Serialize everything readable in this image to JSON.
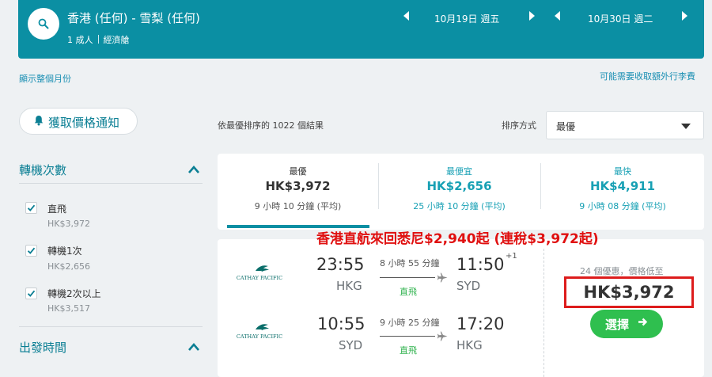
{
  "header": {
    "route": "香港 (任何) - 雪梨 (任何)",
    "passengers": "1 成人",
    "cabin": "經濟艙",
    "depart_date": "10月19日 週五",
    "return_date": "10月30日 週二"
  },
  "links": {
    "show_month": "顯示整個月份",
    "extra_baggage": "可能需要收取額外行李費"
  },
  "sidebar": {
    "price_alert": "獲取價格通知",
    "stops_title": "轉機次數",
    "stops": [
      {
        "label": "直飛",
        "price": "HK$3,972",
        "checked": true
      },
      {
        "label": "轉機1次",
        "price": "HK$2,656",
        "checked": true
      },
      {
        "label": "轉機2次以上",
        "price": "HK$3,517",
        "checked": true
      }
    ],
    "departure_title": "出發時間"
  },
  "sort": {
    "results": "依最優排序的 1022 個結果",
    "label": "排序方式",
    "value": "最優"
  },
  "tabs": [
    {
      "label": "最優",
      "price": "HK$3,972",
      "duration": "9 小時 10 分鐘 (平均)"
    },
    {
      "label": "最便宜",
      "price": "HK$2,656",
      "duration": "25 小時 10 分鐘 (平均)"
    },
    {
      "label": "最快",
      "price": "HK$4,911",
      "duration": "9 小時 08 分鐘 (平均)"
    }
  ],
  "promo": "香港直航來回悉尼$2,940起 (連稅$3,972起)",
  "flight": {
    "airline": "CATHAY PACIFIC",
    "outbound": {
      "depart_time": "23:55",
      "depart_code": "HKG",
      "duration": "8 小時 55 分鐘",
      "stops": "直飛",
      "arrive_time": "11:50",
      "day_offset": "+1",
      "arrive_code": "SYD"
    },
    "inbound": {
      "depart_time": "10:55",
      "depart_code": "SYD",
      "duration": "9 小時 25 分鐘",
      "stops": "直飛",
      "arrive_time": "17:20",
      "arrive_code": "HKG"
    },
    "deals": "24 個優惠，價格低至",
    "price": "HK$3,972",
    "select_label": "選擇"
  },
  "colors": {
    "header_bg": "#0b8fa3",
    "accent_teal": "#17a0b4",
    "promo_red": "#e01010",
    "select_green": "#2fbf4f"
  },
  "icons": {
    "search": "search-icon",
    "prev": "chevron-left-icon",
    "next": "chevron-right-icon",
    "bell": "bell-icon",
    "collapse": "chevron-up-icon",
    "dropdown": "caret-down-icon",
    "plane": "airplane-icon",
    "arrow": "arrow-right-icon"
  }
}
